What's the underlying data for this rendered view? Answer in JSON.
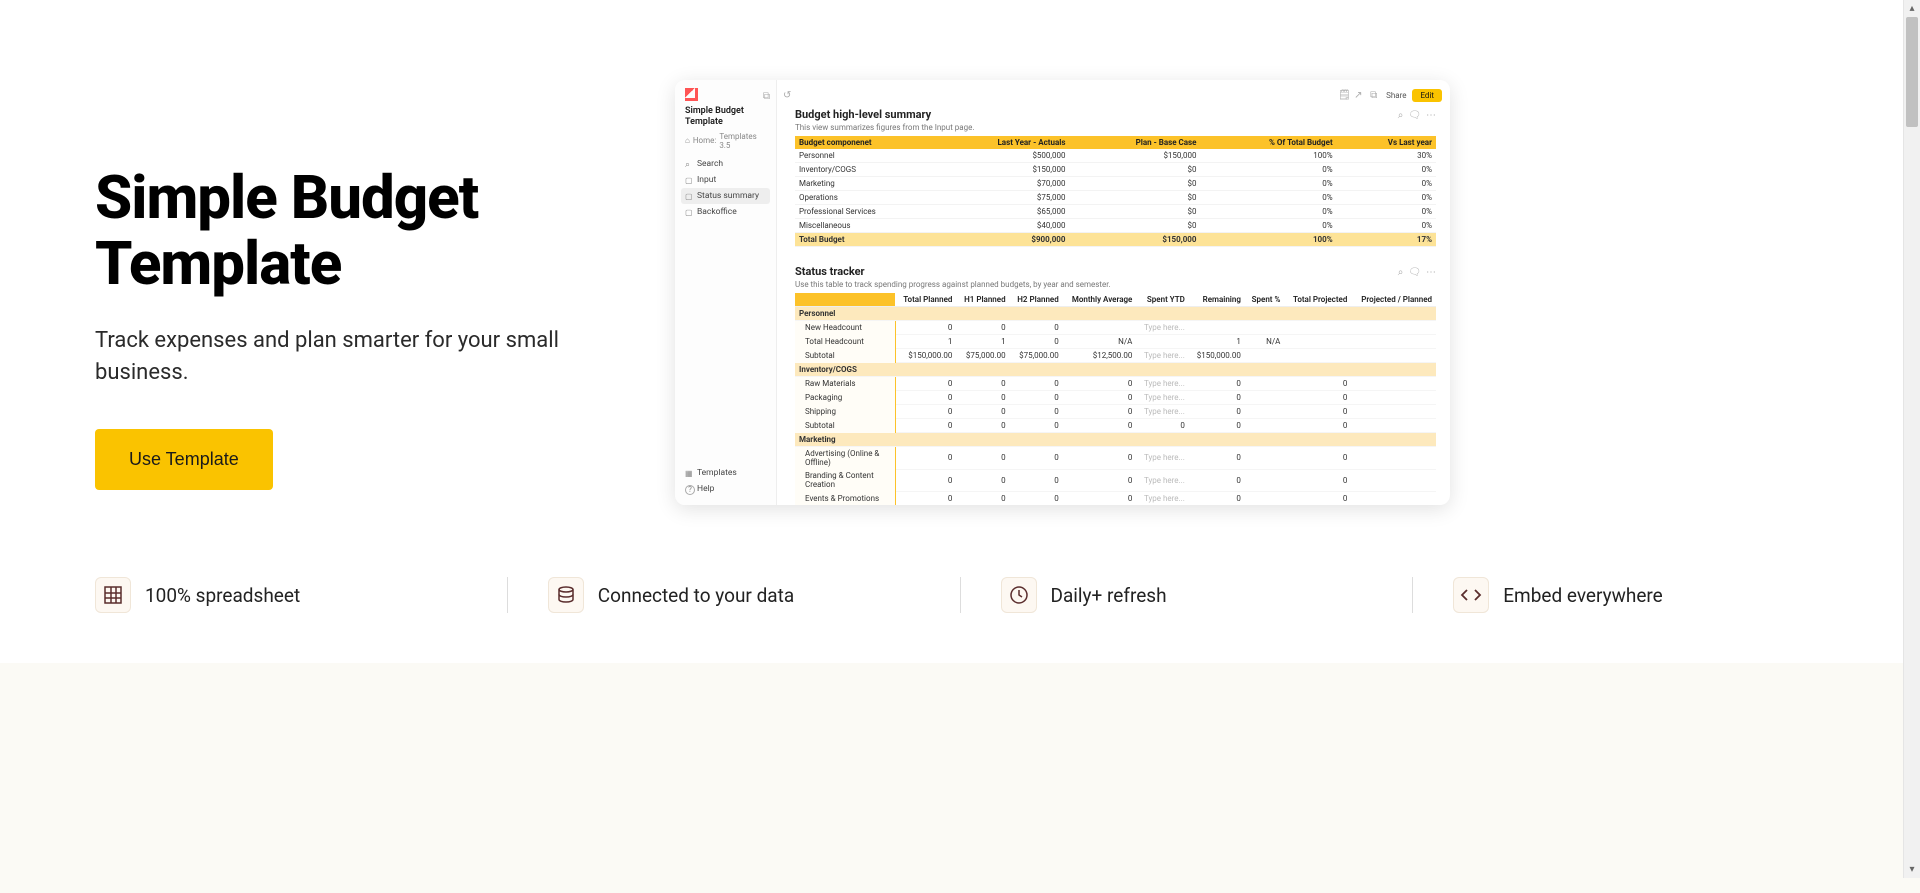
{
  "hero": {
    "title": "Simple Budget Template",
    "subtitle": "Track expenses and plan smarter for your small business.",
    "cta": "Use Template"
  },
  "features": [
    {
      "icon": "grid",
      "label": "100% spreadsheet"
    },
    {
      "icon": "db",
      "label": "Connected to your data"
    },
    {
      "icon": "clock",
      "label": "Daily+ refresh"
    },
    {
      "icon": "code",
      "label": "Embed everywhere"
    }
  ],
  "preview": {
    "sidebar_title": "Simple Budget Template",
    "breadcrumb_home": "Home:",
    "breadcrumb_section": "Templates 3.5",
    "nav": {
      "search": "Search",
      "input": "Input",
      "status_summary": "Status summary",
      "backoffice": "Backoffice",
      "templates": "Templates",
      "help": "Help"
    },
    "topbar": {
      "share": "Share",
      "edit": "Edit"
    },
    "summary": {
      "title": "Budget high-level summary",
      "subtitle": "This view summarizes figures from the Input page.",
      "cols": {
        "component": "Budget componenet",
        "last_year": "Last Year - Actuals",
        "plan": "Plan - Base Case",
        "pct_total": "% Of Total Budget",
        "vs_last": "Vs Last year"
      },
      "rows": [
        {
          "name": "Personnel",
          "last_year": "$500,000",
          "plan": "$150,000",
          "pct_total": "100%",
          "vs_last": "30%"
        },
        {
          "name": "Inventory/COGS",
          "last_year": "$150,000",
          "plan": "$0",
          "pct_total": "0%",
          "vs_last": "0%"
        },
        {
          "name": "Marketing",
          "last_year": "$70,000",
          "plan": "$0",
          "pct_total": "0%",
          "vs_last": "0%"
        },
        {
          "name": "Operations",
          "last_year": "$75,000",
          "plan": "$0",
          "pct_total": "0%",
          "vs_last": "0%"
        },
        {
          "name": "Professional Services",
          "last_year": "$65,000",
          "plan": "$0",
          "pct_total": "0%",
          "vs_last": "0%"
        },
        {
          "name": "Miscellaneous",
          "last_year": "$40,000",
          "plan": "$0",
          "pct_total": "0%",
          "vs_last": "0%"
        }
      ],
      "total": {
        "name": "Total Budget",
        "last_year": "$900,000",
        "plan": "$150,000",
        "pct_total": "100%",
        "vs_last": "17%"
      }
    },
    "tracker": {
      "title": "Status tracker",
      "subtitle": "Use this table to track spending progress against planned budgets, by year and semester.",
      "cols": [
        "Total Planned",
        "H1 Planned",
        "H2 Planned",
        "Monthly Average",
        "Spent YTD",
        "Remaining",
        "Spent %",
        "Total Projected",
        "Projected / Planned"
      ],
      "placeholder": "Type here...",
      "sections": [
        {
          "name": "Personnel",
          "rows": [
            {
              "name": "New Headcount",
              "tp": "0",
              "h1": "0",
              "h2": "0",
              "avg": "",
              "spent": "Type here...",
              "rem": "",
              "sp": "",
              "proj": "",
              "pp": ""
            },
            {
              "name": "Total Headcount",
              "tp": "1",
              "h1": "1",
              "h2": "0",
              "avg": "N/A",
              "spent": "",
              "rem": "1",
              "sp": "N/A",
              "proj": "",
              "pp": ""
            },
            {
              "name": "Subtotal",
              "tp": "$150,000.00",
              "h1": "$75,000.00",
              "h2": "$75,000.00",
              "avg": "$12,500.00",
              "spent": "Type here...",
              "rem": "$150,000.00",
              "sp": "",
              "proj": "",
              "pp": ""
            }
          ]
        },
        {
          "name": "Inventory/COGS",
          "rows": [
            {
              "name": "Raw Materials",
              "tp": "0",
              "h1": "0",
              "h2": "0",
              "avg": "0",
              "spent": "Type here...",
              "rem": "0",
              "sp": "",
              "proj": "0",
              "pp": ""
            },
            {
              "name": "Packaging",
              "tp": "0",
              "h1": "0",
              "h2": "0",
              "avg": "0",
              "spent": "Type here...",
              "rem": "0",
              "sp": "",
              "proj": "0",
              "pp": ""
            },
            {
              "name": "Shipping",
              "tp": "0",
              "h1": "0",
              "h2": "0",
              "avg": "0",
              "spent": "Type here...",
              "rem": "0",
              "sp": "",
              "proj": "0",
              "pp": ""
            },
            {
              "name": "Subtotal",
              "tp": "0",
              "h1": "0",
              "h2": "0",
              "avg": "0",
              "spent": "0",
              "rem": "0",
              "sp": "",
              "proj": "0",
              "pp": ""
            }
          ]
        },
        {
          "name": "Marketing",
          "rows": [
            {
              "name": "Advertising (Online & Offline)",
              "tp": "0",
              "h1": "0",
              "h2": "0",
              "avg": "0",
              "spent": "Type here...",
              "rem": "0",
              "sp": "",
              "proj": "0",
              "pp": ""
            },
            {
              "name": "Branding & Content Creation",
              "tp": "0",
              "h1": "0",
              "h2": "0",
              "avg": "0",
              "spent": "Type here...",
              "rem": "0",
              "sp": "",
              "proj": "0",
              "pp": ""
            },
            {
              "name": "Events & Promotions",
              "tp": "0",
              "h1": "0",
              "h2": "0",
              "avg": "0",
              "spent": "Type here...",
              "rem": "0",
              "sp": "",
              "proj": "0",
              "pp": ""
            }
          ]
        }
      ]
    }
  }
}
